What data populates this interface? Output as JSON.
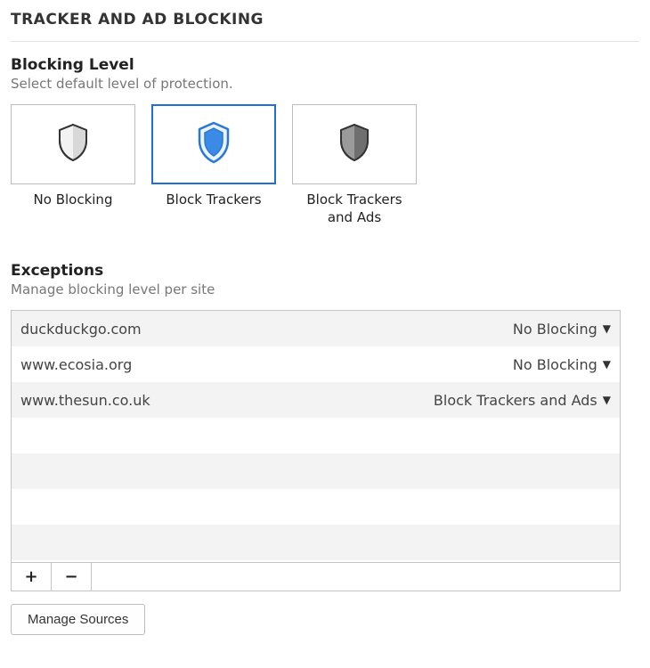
{
  "title": "TRACKER AND AD BLOCKING",
  "blocking_level": {
    "heading": "Blocking Level",
    "sub": "Select default level of protection.",
    "selected_index": 1,
    "options": [
      {
        "label": "No Blocking"
      },
      {
        "label": "Block Trackers"
      },
      {
        "label": "Block Trackers and Ads"
      }
    ]
  },
  "exceptions": {
    "heading": "Exceptions",
    "sub": "Manage blocking level per site",
    "rows": [
      {
        "domain": "duckduckgo.com",
        "level": "No Blocking"
      },
      {
        "domain": "www.ecosia.org",
        "level": "No Blocking"
      },
      {
        "domain": "www.thesun.co.uk",
        "level": "Block Trackers and Ads"
      }
    ],
    "add_label": "+",
    "remove_label": "−"
  },
  "manage_sources_label": "Manage Sources"
}
